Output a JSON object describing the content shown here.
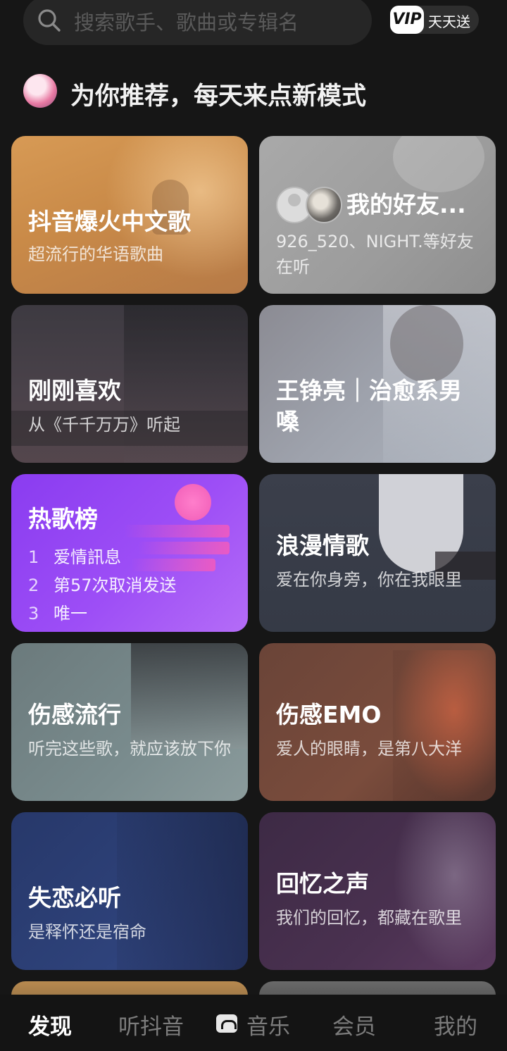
{
  "search": {
    "placeholder": "搜索歌手、歌曲或专辑名"
  },
  "vip": {
    "badge": "VIP",
    "label": "天天送"
  },
  "recommend": {
    "title": "为你推荐，每天来点新模式"
  },
  "cards": [
    {
      "title": "抖音爆火中文歌",
      "subtitle": "超流行的华语歌曲"
    },
    {
      "title": "我的好友...",
      "subtitle": "926_520、NIGHT.等好友在听"
    },
    {
      "title": "刚刚喜欢",
      "subtitle": "从《千千万万》听起"
    },
    {
      "title": "王铮亮｜治愈系男嗓",
      "subtitle": ""
    },
    {
      "title": "热歌榜",
      "list": [
        {
          "rank": "1",
          "song": "爱情訊息"
        },
        {
          "rank": "2",
          "song": "第57次取消发送"
        },
        {
          "rank": "3",
          "song": "唯一"
        }
      ]
    },
    {
      "title": "浪漫情歌",
      "subtitle": "爱在你身旁，你在我眼里"
    },
    {
      "title": "伤感流行",
      "subtitle": "听完这些歌，就应该放下你"
    },
    {
      "title": "伤感EMO",
      "subtitle": "爱人的眼睛，是第八大洋"
    },
    {
      "title": "失恋必听",
      "subtitle": "是释怀还是宿命"
    },
    {
      "title": "回忆之声",
      "subtitle": "我们的回忆，都藏在歌里"
    }
  ],
  "nav": {
    "items": [
      "发现",
      "听抖音",
      "音乐",
      "会员",
      "我的"
    ],
    "active": "发现"
  }
}
